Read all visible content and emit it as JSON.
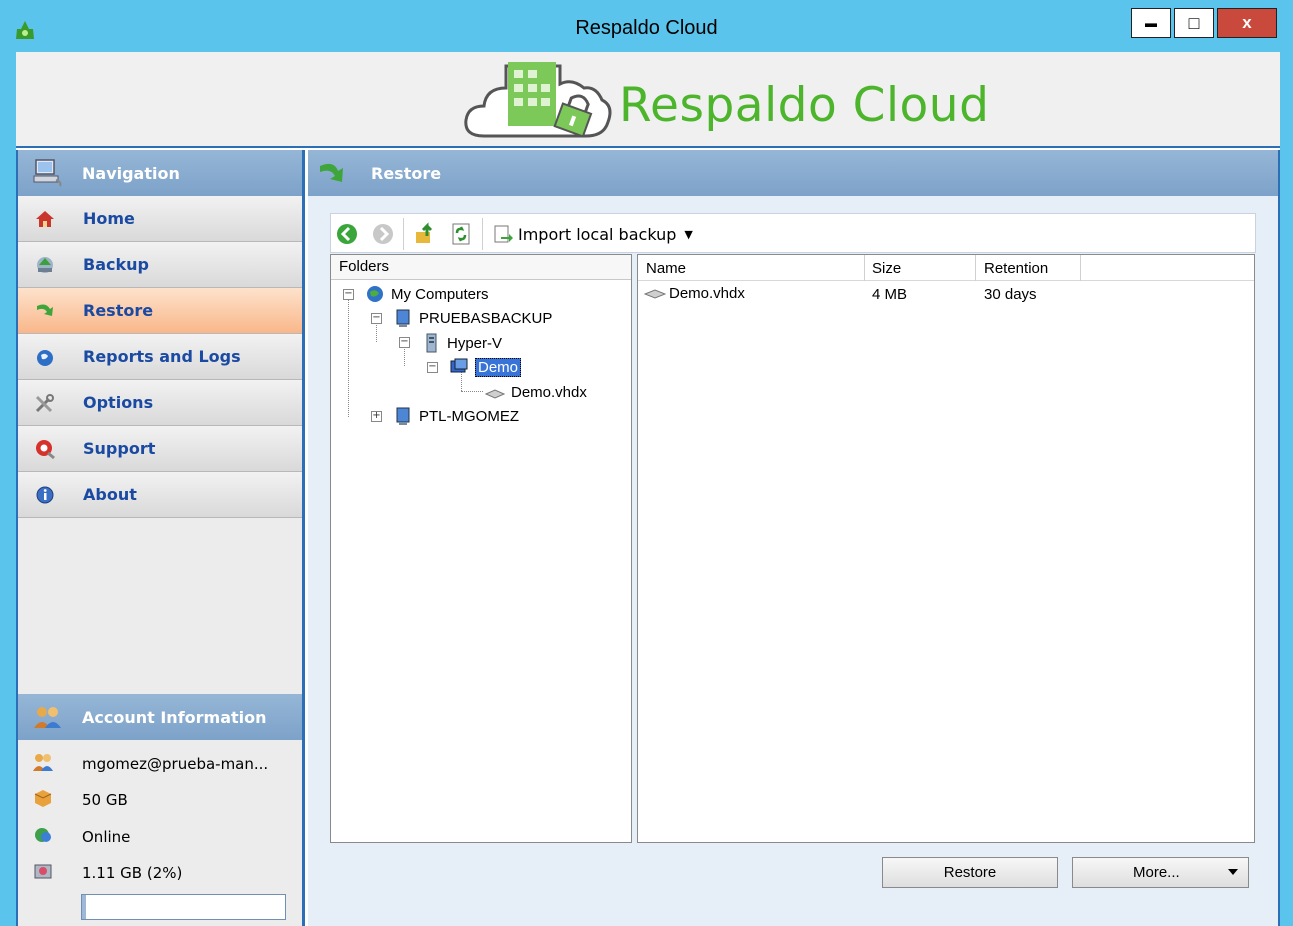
{
  "window": {
    "title": "Respaldo Cloud",
    "minimize_glyph": "▬",
    "maximize_glyph": "□",
    "close_glyph": "x",
    "titlebar_color": "#5bc4ec",
    "close_color": "#c94a3c"
  },
  "banner": {
    "brand_name": "Respaldo Cloud",
    "brand_color": "#4cb52c",
    "logo_icon": "cloud-building-lock-icon"
  },
  "nav": {
    "header": "Navigation",
    "header_icon": "computer-network-icon",
    "items": [
      {
        "label": "Home",
        "icon": "home-icon",
        "active": false
      },
      {
        "label": "Backup",
        "icon": "backup-icon",
        "active": false
      },
      {
        "label": "Restore",
        "icon": "restore-arrow-icon",
        "active": true
      },
      {
        "label": "Reports and Logs",
        "icon": "reports-globe-icon",
        "active": false
      },
      {
        "label": "Options",
        "icon": "tools-icon",
        "active": false
      },
      {
        "label": "Support",
        "icon": "lifebuoy-icon",
        "active": false
      },
      {
        "label": "About",
        "icon": "info-icon",
        "active": false
      }
    ]
  },
  "account": {
    "header": "Account Information",
    "header_icon": "users-icon",
    "email": "mgomez@prueba-man...",
    "quota": "50 GB",
    "status": "Online",
    "usage": "1.11 GB (2%)",
    "usage_fraction": 0.02
  },
  "main": {
    "header": "Restore",
    "header_icon": "restore-arrow-icon",
    "toolbar": {
      "import_label": "Import local backup",
      "buttons": [
        "back-icon",
        "forward-icon",
        "up-folder-icon",
        "refresh-icon"
      ]
    },
    "folders": {
      "header": "Folders",
      "nodes": {
        "root": "My Computers",
        "computer1": "PRUEBASBACKUP",
        "hyperv": "Hyper-V",
        "vm": "Demo",
        "disk": "Demo.vhdx",
        "computer2": "PTL-MGOMEZ"
      }
    },
    "files": {
      "columns": {
        "name": "Name",
        "size": "Size",
        "retention": "Retention"
      },
      "rows": [
        {
          "name": "Demo.vhdx",
          "size": "4 MB",
          "retention": "30 days"
        }
      ]
    },
    "buttons": {
      "restore": "Restore",
      "more": "More..."
    }
  }
}
